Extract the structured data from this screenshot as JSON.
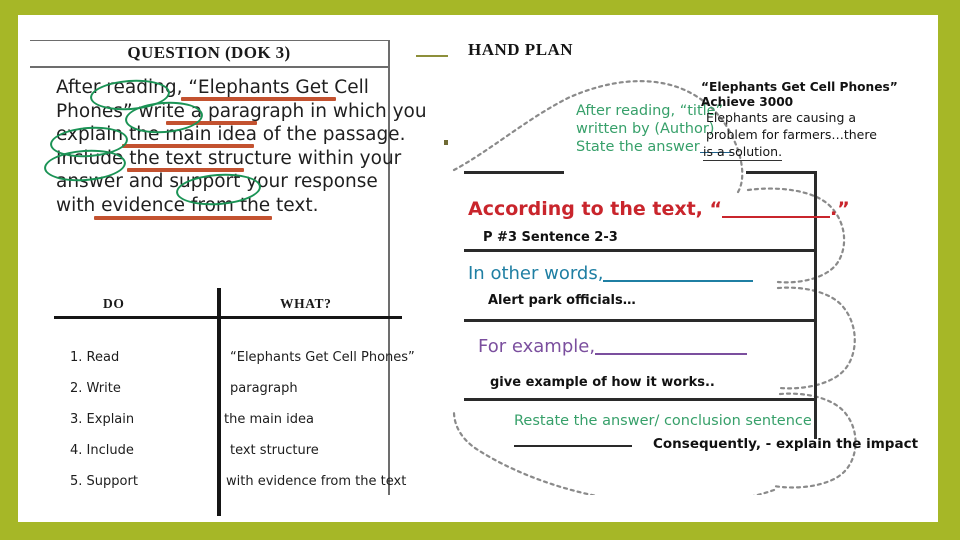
{
  "slide": {
    "background_color": "#a6b727",
    "card_color": "#ffffff"
  },
  "question_panel": {
    "title": "QUESTION (DOK 3)",
    "prompt_lines": [
      "After reading, “Elephants Get Cell",
      "Phones” write a paragraph in which you",
      "explain the main idea of the passage.",
      "Include the text structure within your",
      "answer  and support your response",
      "with evidence from the text."
    ],
    "underline_color": "#c35230",
    "circle_color": "#1a9355",
    "circled_words": [
      "reading",
      "write",
      "explain",
      "Include",
      "support"
    ],
    "underlined_phrases": [
      "Elephants Get Cell",
      "paragraph",
      "the main idea",
      "text structure",
      "evidence from the text"
    ]
  },
  "do_what_table": {
    "headers": {
      "left": "DO",
      "right": "WHAT?"
    },
    "rows": [
      {
        "do": "1. Read",
        "what": "“Elephants Get Cell Phones”"
      },
      {
        "do": "2. Write",
        "what": "paragraph"
      },
      {
        "do": "3. Explain",
        "what": "the main idea"
      },
      {
        "do": "4. Include",
        "what": "text structure"
      },
      {
        "do": "5. Support",
        "what": "with evidence from the text"
      }
    ]
  },
  "hand_plan": {
    "title": "HAND PLAN",
    "thumb_prompt": {
      "line1": "After reading, “title”",
      "line2": "written by (Author)",
      "line3": "State the answer"
    },
    "thumb_answer": {
      "line1": "“Elephants Get Cell Phones”",
      "line2": "Achieve 3000",
      "line3": "Elephants are causing a",
      "line4": "problem for farmers…there",
      "line5": "is a solution."
    },
    "finger1": {
      "starter_prefix": "According to the text, “",
      "starter_suffix": ".”",
      "note": "P #3 Sentence 2-3",
      "color": "#c9252c"
    },
    "finger2": {
      "starter": "In other words,",
      "note": "Alert park officials…",
      "color": "#1f7fa3"
    },
    "finger3": {
      "starter": "For example,",
      "note": "give example of how it works..",
      "color": "#7b4f9e"
    },
    "conclusion": {
      "green_line": "Restate the answer/ conclusion sentence",
      "black_line": "Consequently, - explain the impact",
      "green_color": "#37a06a"
    }
  }
}
